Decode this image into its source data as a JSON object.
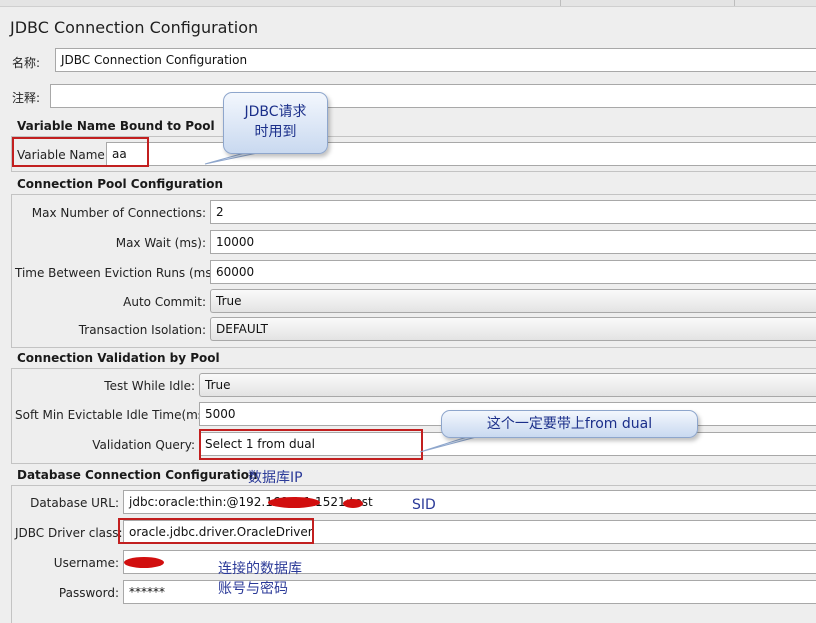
{
  "panel": {
    "title": "JDBC Connection Configuration"
  },
  "name_field": {
    "label": "名称:",
    "value": "JDBC Connection Configuration"
  },
  "comment_field": {
    "label": "注释:",
    "value": ""
  },
  "variable_section": {
    "title": "Variable Name Bound to Pool",
    "variable_name_label": "Variable Name:",
    "variable_name_value": "aa"
  },
  "pool_section": {
    "title": "Connection Pool Configuration",
    "max_connections_label": "Max Number of Connections:",
    "max_connections_value": "2",
    "max_wait_label": "Max Wait (ms):",
    "max_wait_value": "10000",
    "eviction_label": "Time Between Eviction Runs (ms):",
    "eviction_value": "60000",
    "auto_commit_label": "Auto Commit:",
    "auto_commit_value": "True",
    "isolation_label": "Transaction Isolation:",
    "isolation_value": "DEFAULT"
  },
  "validation_section": {
    "title": "Connection Validation by Pool",
    "test_idle_label": "Test While Idle:",
    "test_idle_value": "True",
    "soft_min_label": "Soft Min Evictable Idle Time(ms):",
    "soft_min_value": "5000",
    "query_label": "Validation Query:",
    "query_value": "Select 1 from dual"
  },
  "db_section": {
    "title": "Database Connection Configuration",
    "url_label": "Database URL:",
    "url_value": "jdbc:oracle:thin:@192.168.0.1:1521:test",
    "driver_label": "JDBC Driver class:",
    "driver_value": "oracle.jdbc.driver.OracleDriver",
    "username_label": "Username:",
    "username_value": "",
    "password_label": "Password:",
    "password_value": "******"
  },
  "annotations": {
    "variable_callout_line1": "JDBC请求",
    "variable_callout_line2": "时用到",
    "query_callout": "这个一定要带上from dual",
    "db_ip_note": "数据库IP",
    "sid_note": "SID",
    "account_note_line1": "连接的数据库",
    "account_note_line2": "账号与密码"
  },
  "colors": {
    "highlight_red": "#c21f1f",
    "callout_text": "#1b2f8a",
    "redaction": "#d10e0e"
  }
}
